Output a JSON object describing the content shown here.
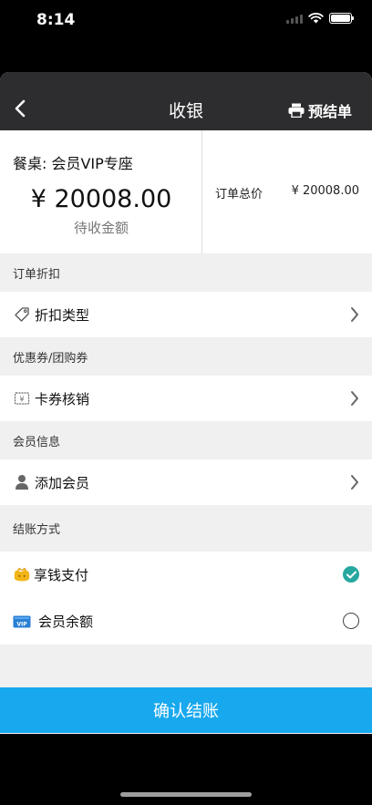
{
  "status_bar": {
    "time": "8:14"
  },
  "nav": {
    "title": "收银",
    "pre_settle_label": "预结单"
  },
  "summary": {
    "table_name": "餐桌: 会员VIP专座",
    "amount": "¥ 20008.00",
    "amount_label": "待收金额",
    "order_total_label": "订单总价",
    "order_total_value": "¥ 20008.00"
  },
  "sections": {
    "discount": {
      "header": "订单折扣",
      "item": "折扣类型"
    },
    "coupon": {
      "header": "优惠券/团购券",
      "item": "卡券核销"
    },
    "member": {
      "header": "会员信息",
      "item": "添加会员"
    },
    "payment": {
      "header": "结账方式",
      "methods": [
        {
          "label": "享钱支付",
          "selected": true
        },
        {
          "label": "会员余额",
          "selected": false
        }
      ]
    }
  },
  "confirm_label": "确认结账",
  "colors": {
    "accent": "#18a8ee",
    "check": "#26a8a0",
    "nav": "#2d2d2f"
  }
}
